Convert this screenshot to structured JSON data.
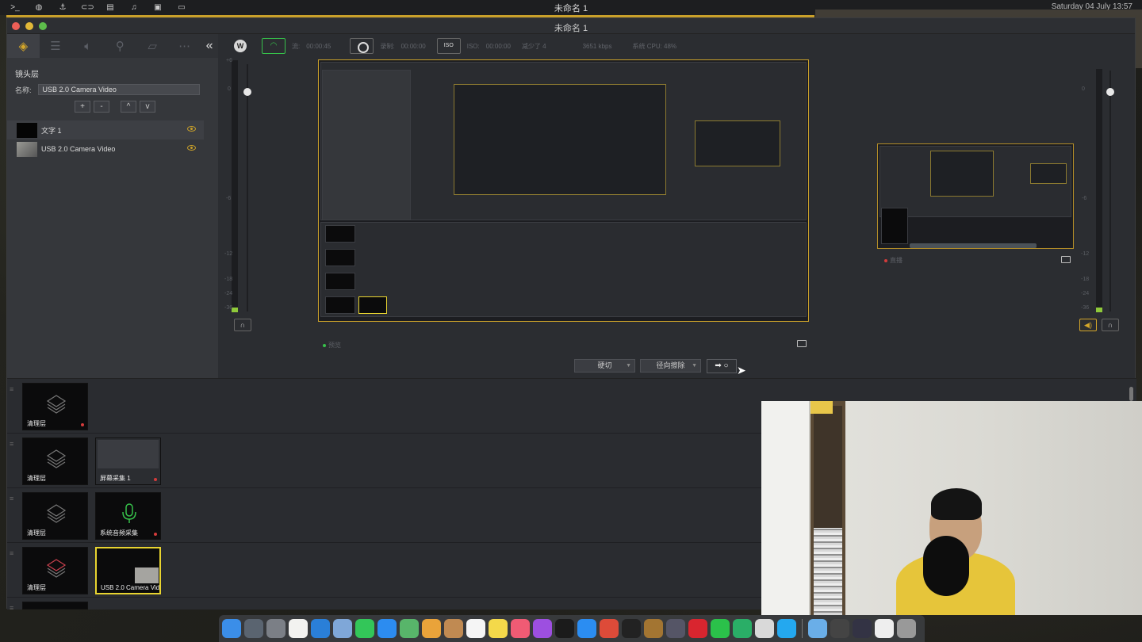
{
  "menubar": {
    "title": "未命名 1",
    "clock": "Saturday 04 July 13:57",
    "icons": [
      "terminal-icon",
      "globe-icon",
      "anchor-icon",
      "link-icon",
      "film-icon",
      "music-icon",
      "book-icon",
      "laptop-icon"
    ]
  },
  "window": {
    "title": "未命名 1"
  },
  "left_panel": {
    "tabs": [
      "layers-icon",
      "sliders-icon",
      "speaker-icon",
      "person-icon",
      "slash-icon",
      "more-icon"
    ],
    "collapse_glyph": "«",
    "section_title": "镜头层",
    "name_label": "名称:",
    "name_value": "USB 2.0 Camera Video",
    "buttons": [
      "+",
      "-",
      "^",
      "v"
    ],
    "layers": [
      {
        "label": "文字 1",
        "visible": true
      },
      {
        "label": "USB 2.0 Camera Video",
        "visible": true
      }
    ]
  },
  "stream_bar": {
    "stream_label": "流:",
    "stream_time": "00:00:45",
    "record_label": "录制:",
    "record_time": "00:00:00",
    "iso_button": "ISO",
    "iso_label": "ISO:",
    "iso_time": "00:00:00",
    "dropped": "减少了 4",
    "bitrate": "3651 kbps",
    "cpu": "系统 CPU: 48%"
  },
  "meters": {
    "left_scale": [
      "+6",
      "0",
      "-6",
      "-12",
      "-18",
      "-24",
      "-36"
    ],
    "right_scale": [
      "0",
      "-6",
      "-12",
      "-18",
      "-24",
      "-36"
    ],
    "left_level": 0.02,
    "right_level": 0.02
  },
  "panes": {
    "preview_label": "预览",
    "program_label": "直播"
  },
  "transition": {
    "type": "硬切",
    "effect": "径向擦除",
    "go": "➡ ○"
  },
  "scenes": [
    {
      "tiles": [
        {
          "label": "清理层"
        }
      ]
    },
    {
      "tiles": [
        {
          "label": "清理层"
        },
        {
          "label": "屏幕采集 1"
        }
      ]
    },
    {
      "tiles": [
        {
          "label": "清理层"
        },
        {
          "label": "系统音频采集"
        }
      ]
    },
    {
      "tiles": [
        {
          "label": "清理层"
        },
        {
          "label": "USB 2.0 Camera Vid"
        }
      ]
    }
  ],
  "dock": {
    "icons": [
      "finder-icon",
      "launchpad-icon",
      "settings-icon",
      "notes-icon",
      "safari-icon",
      "preview-icon",
      "messages-icon",
      "chat-icon",
      "maps-icon",
      "photos-icon",
      "contacts-icon",
      "calendar-icon",
      "files-icon",
      "music-icon",
      "podcasts-icon",
      "appletv-icon",
      "appstore-icon",
      "chrome-icon",
      "piano-icon",
      "bottle-icon",
      "game-icon",
      "netease-icon",
      "wechat-icon",
      "wechat-alt-icon",
      "wirecast-icon",
      "qq-icon",
      "folder-icon",
      "screenshot-icon",
      "display-icon",
      "doc-icon",
      "trash-icon"
    ],
    "colors": [
      "#3b8ee8",
      "#5a6470",
      "#7b7f86",
      "#f2f2f0",
      "#2a7fd8",
      "#7fa7d8",
      "#33c659",
      "#2c8cf0",
      "#58b56a",
      "#e9a33a",
      "#c08a52",
      "#f5f5f5",
      "#f4d94a",
      "#f05b74",
      "#9d4fe0",
      "#1b1b1b",
      "#2b8df2",
      "#dd4b39",
      "#222",
      "#a37532",
      "#556",
      "#d9252f",
      "#2bc14a",
      "#2aae67",
      "#d9d9d9",
      "#24a8ef",
      "#6aaee8",
      "#444",
      "#334",
      "#eee",
      "#999"
    ]
  },
  "colors": {
    "accent": "#c9a02a",
    "live_green": "#36c14a",
    "selection": "#e8d430"
  }
}
